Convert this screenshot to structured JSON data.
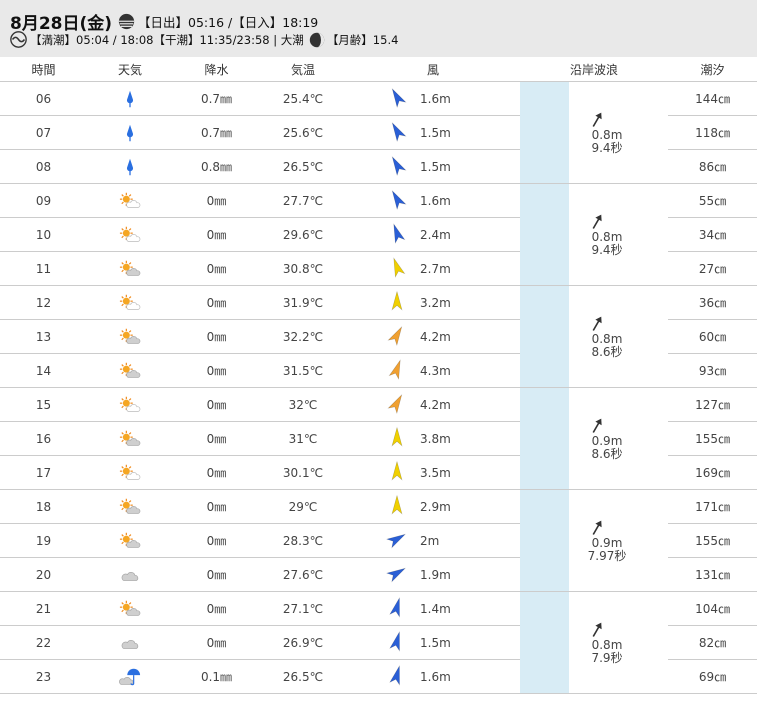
{
  "header": {
    "date": "8月28日(金)",
    "sun_text": "【日出】05:16 /【日入】18:19",
    "tide_text": "【満潮】05:04 / 18:08【干潮】11:35/23:58 | 大潮",
    "moon_text": "【月齢】15.4"
  },
  "columns": [
    "時間",
    "天気",
    "降水",
    "気温",
    "風",
    "沿岸波浪",
    "潮汐"
  ],
  "rows": [
    {
      "hour": "06",
      "weather": "rain",
      "precip": "0.7㎜",
      "temp": "25.4℃",
      "wind_dir": 330,
      "wind_color": "#2a5fd6",
      "wind": "1.6m",
      "tide": "144㎝"
    },
    {
      "hour": "07",
      "weather": "rain",
      "precip": "0.7㎜",
      "temp": "25.6℃",
      "wind_dir": 330,
      "wind_color": "#2a5fd6",
      "wind": "1.5m",
      "tide": "118㎝"
    },
    {
      "hour": "08",
      "weather": "rain",
      "precip": "0.8㎜",
      "temp": "26.5℃",
      "wind_dir": 330,
      "wind_color": "#2a5fd6",
      "wind": "1.5m",
      "tide": "86㎝"
    },
    {
      "hour": "09",
      "weather": "sun-cloud",
      "precip": "0㎜",
      "temp": "27.7℃",
      "wind_dir": 330,
      "wind_color": "#2a5fd6",
      "wind": "1.6m",
      "tide": "55㎝"
    },
    {
      "hour": "10",
      "weather": "sun-cloud",
      "precip": "0㎜",
      "temp": "29.6℃",
      "wind_dir": 340,
      "wind_color": "#2a5fd6",
      "wind": "2.4m",
      "tide": "34㎝"
    },
    {
      "hour": "11",
      "weather": "sun-cloud-grey",
      "precip": "0㎜",
      "temp": "30.8℃",
      "wind_dir": 340,
      "wind_color": "#f0d000",
      "wind": "2.7m",
      "tide": "27㎝"
    },
    {
      "hour": "12",
      "weather": "sun-cloud",
      "precip": "0㎜",
      "temp": "31.9℃",
      "wind_dir": 0,
      "wind_color": "#f0d000",
      "wind": "3.2m",
      "tide": "36㎝"
    },
    {
      "hour": "13",
      "weather": "sun-cloud-grey",
      "precip": "0㎜",
      "temp": "32.2℃",
      "wind_dir": 30,
      "wind_color": "#f0a030",
      "wind": "4.2m",
      "tide": "60㎝"
    },
    {
      "hour": "14",
      "weather": "sun-cloud-grey",
      "precip": "0㎜",
      "temp": "31.5℃",
      "wind_dir": 20,
      "wind_color": "#f0a030",
      "wind": "4.3m",
      "tide": "93㎝"
    },
    {
      "hour": "15",
      "weather": "sun-cloud",
      "precip": "0㎜",
      "temp": "32℃",
      "wind_dir": 30,
      "wind_color": "#f0a030",
      "wind": "4.2m",
      "tide": "127㎝"
    },
    {
      "hour": "16",
      "weather": "sun-cloud-grey",
      "precip": "0㎜",
      "temp": "31℃",
      "wind_dir": 0,
      "wind_color": "#f0d000",
      "wind": "3.8m",
      "tide": "155㎝"
    },
    {
      "hour": "17",
      "weather": "sun-cloud",
      "precip": "0㎜",
      "temp": "30.1℃",
      "wind_dir": 0,
      "wind_color": "#f0d000",
      "wind": "3.5m",
      "tide": "169㎝"
    },
    {
      "hour": "18",
      "weather": "sun-cloud-grey",
      "precip": "0㎜",
      "temp": "29℃",
      "wind_dir": 0,
      "wind_color": "#f0d000",
      "wind": "2.9m",
      "tide": "171㎝"
    },
    {
      "hour": "19",
      "weather": "sun-cloud-grey",
      "precip": "0㎜",
      "temp": "28.3℃",
      "wind_dir": 60,
      "wind_color": "#2a5fd6",
      "wind": "2m",
      "tide": "155㎝"
    },
    {
      "hour": "20",
      "weather": "cloud",
      "precip": "0㎜",
      "temp": "27.6℃",
      "wind_dir": 60,
      "wind_color": "#2a5fd6",
      "wind": "1.9m",
      "tide": "131㎝"
    },
    {
      "hour": "21",
      "weather": "sun-cloud-grey",
      "precip": "0㎜",
      "temp": "27.1℃",
      "wind_dir": 15,
      "wind_color": "#2a5fd6",
      "wind": "1.4m",
      "tide": "104㎝"
    },
    {
      "hour": "22",
      "weather": "cloud",
      "precip": "0㎜",
      "temp": "26.9℃",
      "wind_dir": 15,
      "wind_color": "#2a5fd6",
      "wind": "1.5m",
      "tide": "82㎝"
    },
    {
      "hour": "23",
      "weather": "cloud-umbrella",
      "precip": "0.1㎜",
      "temp": "26.5℃",
      "wind_dir": 15,
      "wind_color": "#2a5fd6",
      "wind": "1.6m",
      "tide": "69㎝"
    }
  ],
  "waves": [
    {
      "dir": 30,
      "height": "0.8m",
      "period": "9.4秒"
    },
    {
      "dir": 30,
      "height": "0.8m",
      "period": "9.4秒"
    },
    {
      "dir": 30,
      "height": "0.8m",
      "period": "8.6秒"
    },
    {
      "dir": 30,
      "height": "0.9m",
      "period": "8.6秒"
    },
    {
      "dir": 30,
      "height": "0.9m",
      "period": "7.97秒"
    },
    {
      "dir": 30,
      "height": "0.8m",
      "period": "7.9秒"
    }
  ]
}
